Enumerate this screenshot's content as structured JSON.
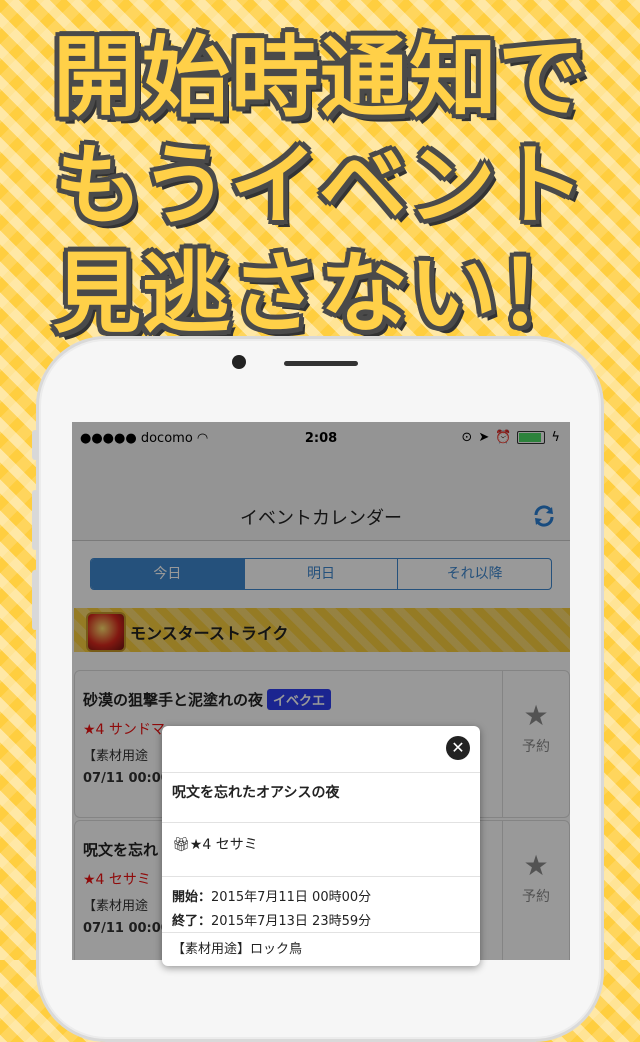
{
  "headline": {
    "line1": "開始時通知で",
    "line2": "もうイベント",
    "line3": "見逃さない！"
  },
  "status_bar": {
    "carrier": "●●●●● docomo",
    "time": "2:08"
  },
  "nav": {
    "title": "イベントカレンダー",
    "refresh_icon": "refresh-icon"
  },
  "tabs": [
    {
      "label": "今日",
      "active": true
    },
    {
      "label": "明日"
    },
    {
      "label": "それ以降"
    }
  ],
  "game": {
    "name": "モンスターストライク"
  },
  "events": [
    {
      "title": "砂漠の狙撃手と泥塗れの夜",
      "badge": "イベクエ",
      "reward": "★4 サンドマ",
      "material": "【素材用途",
      "datetime": "07/11 00:00",
      "reserve_label": "予約"
    },
    {
      "title": "呪文を忘れ",
      "reward": "★4 セサミ",
      "material": "【素材用途",
      "datetime": "07/11 00:00",
      "reserve_label": "予約"
    }
  ],
  "popup": {
    "title": "呪文を忘れたオアシスの夜",
    "reward": "★4 セサミ",
    "start_label": "開始：",
    "start_value": "2015年7月11日 00時00分",
    "end_label": "終了：",
    "end_value": "2015年7月13日 23時59分",
    "material": "【素材用途】ロック鳥"
  }
}
